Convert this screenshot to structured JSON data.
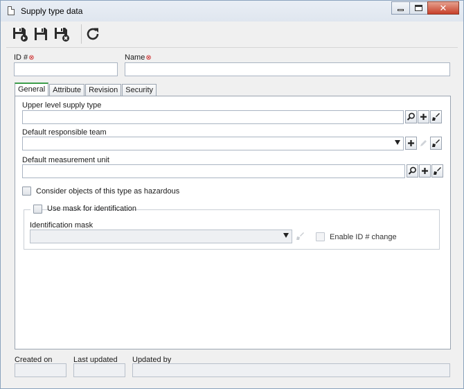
{
  "window": {
    "title": "Supply type data",
    "buttons": {
      "minimize": "minimize",
      "maximize": "maximize",
      "close": "close"
    }
  },
  "toolbar": {
    "save_new_icon": "save-and-new-icon",
    "save_icon": "save-icon",
    "save_close_icon": "save-and-close-icon",
    "refresh_icon": "refresh-icon"
  },
  "fields": {
    "id_label": "ID #",
    "id_value": "",
    "name_label": "Name",
    "name_value": "",
    "required_marker": "⊗"
  },
  "tabs": [
    {
      "label": "General",
      "active": true
    },
    {
      "label": "Attribute",
      "active": false
    },
    {
      "label": "Revision",
      "active": false
    },
    {
      "label": "Security",
      "active": false
    }
  ],
  "general": {
    "upper_level_label": "Upper level supply type",
    "upper_level_value": "",
    "responsible_team_label": "Default responsible team",
    "responsible_team_value": "",
    "measurement_unit_label": "Default measurement unit",
    "measurement_unit_value": "",
    "hazardous_label": "Consider objects of this type as hazardous",
    "hazardous_checked": false,
    "use_mask_label": "Use mask for identification",
    "use_mask_checked": false,
    "identification_mask_label": "Identification mask",
    "identification_mask_value": "",
    "enable_id_change_label": "Enable ID # change",
    "enable_id_change_checked": false
  },
  "footer": {
    "created_on_label": "Created on",
    "created_on_value": "",
    "last_updated_label": "Last updated",
    "last_updated_value": "",
    "updated_by_label": "Updated by",
    "updated_by_value": ""
  },
  "colors": {
    "required": "#cc1f1f",
    "active_tab_accent": "#3c9d4a",
    "close_button": "#c7402a"
  }
}
